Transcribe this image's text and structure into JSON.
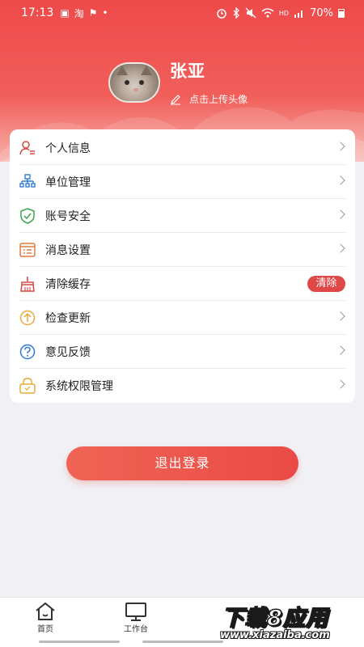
{
  "status_bar": {
    "time": "17:13",
    "left_icons": [
      "photo-icon",
      "taobao-icon",
      "app-icon",
      "dot-icon"
    ],
    "left_glyphs": [
      "▣",
      "淘",
      "⚑",
      "•"
    ],
    "battery": "70%",
    "right_icons": [
      "alarm-icon",
      "bluetooth-icon",
      "mute-icon",
      "wifi-icon",
      "hd-icon",
      "signal-icon",
      "battery-icon"
    ]
  },
  "profile": {
    "name": "张亚",
    "upload_hint": "点击上传头像"
  },
  "menu": {
    "items": [
      {
        "label": "个人信息",
        "icon": "person-info-icon"
      },
      {
        "label": "单位管理",
        "icon": "org-chart-icon"
      },
      {
        "label": "账号安全",
        "icon": "shield-icon"
      },
      {
        "label": "消息设置",
        "icon": "message-settings-icon"
      },
      {
        "label": "清除缓存",
        "icon": "broom-icon",
        "action_label": "清除"
      },
      {
        "label": "检查更新",
        "icon": "update-arrow-icon"
      },
      {
        "label": "意见反馈",
        "icon": "question-icon"
      },
      {
        "label": "系统权限管理",
        "icon": "permission-icon"
      }
    ]
  },
  "logout_label": "退出登录",
  "tabbar": {
    "tabs": [
      {
        "label": "首页",
        "icon": "home-icon"
      },
      {
        "label": "工作台",
        "icon": "monitor-icon"
      }
    ]
  },
  "watermark": {
    "title": "下载8应用",
    "url": "www.xiazaiba.com"
  },
  "colors": {
    "brand_red": "#ee4a4a",
    "clear_badge": "#e04848",
    "background": "#f1f1f5"
  }
}
